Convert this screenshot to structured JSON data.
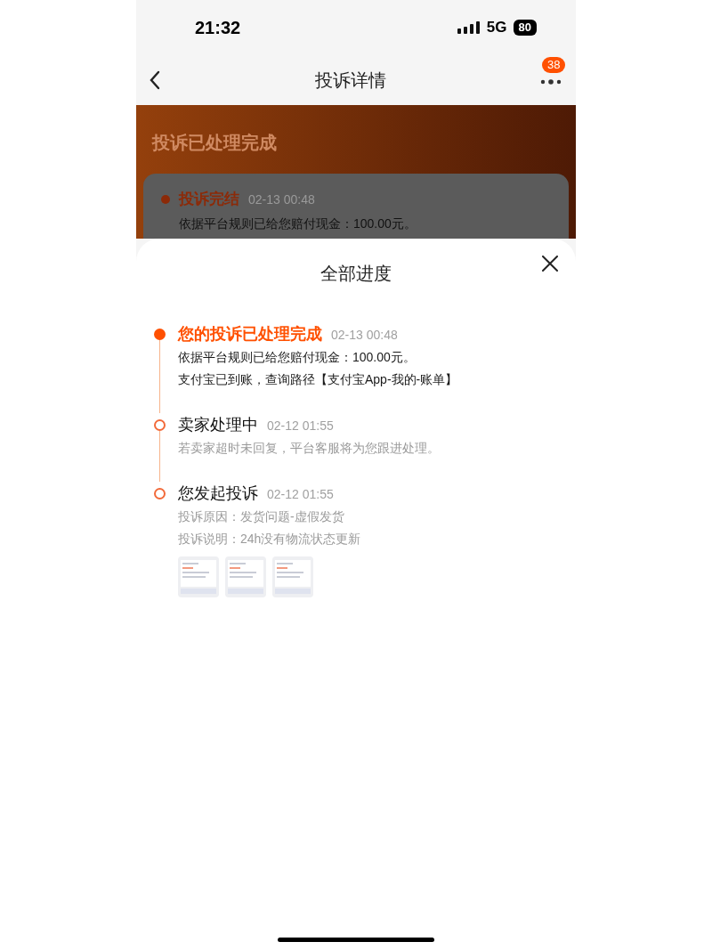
{
  "status_bar": {
    "time": "21:32",
    "network": "5G",
    "battery": "80"
  },
  "nav": {
    "title": "投诉详情",
    "badge": "38"
  },
  "banner": {
    "title": "投诉已处理完成"
  },
  "summary_card": {
    "title": "投诉完结",
    "time": "02-13 00:48",
    "text": "依据平台规则已给您赔付现金：100.00元。"
  },
  "sheet": {
    "title": "全部进度",
    "steps": [
      {
        "title": "您的投诉已处理完成",
        "time": "02-13 00:48",
        "active": true,
        "lines": [
          "依据平台规则已给您赔付现金：100.00元。",
          "支付宝已到账，查询路径【支付宝App-我的-账单】"
        ],
        "muted": false
      },
      {
        "title": "卖家处理中",
        "time": "02-12 01:55",
        "active": false,
        "lines": [
          "若卖家超时未回复，平台客服将为您跟进处理。"
        ],
        "muted": true
      },
      {
        "title": "您发起投诉",
        "time": "02-12 01:55",
        "active": false,
        "lines": [
          "投诉原因：发货问题-虚假发货",
          "投诉说明：24h没有物流状态更新"
        ],
        "muted": true,
        "attachments": [
          {
            "kind": "picture"
          },
          {
            "kind": "picture"
          },
          {
            "kind": "picture"
          }
        ]
      }
    ]
  }
}
